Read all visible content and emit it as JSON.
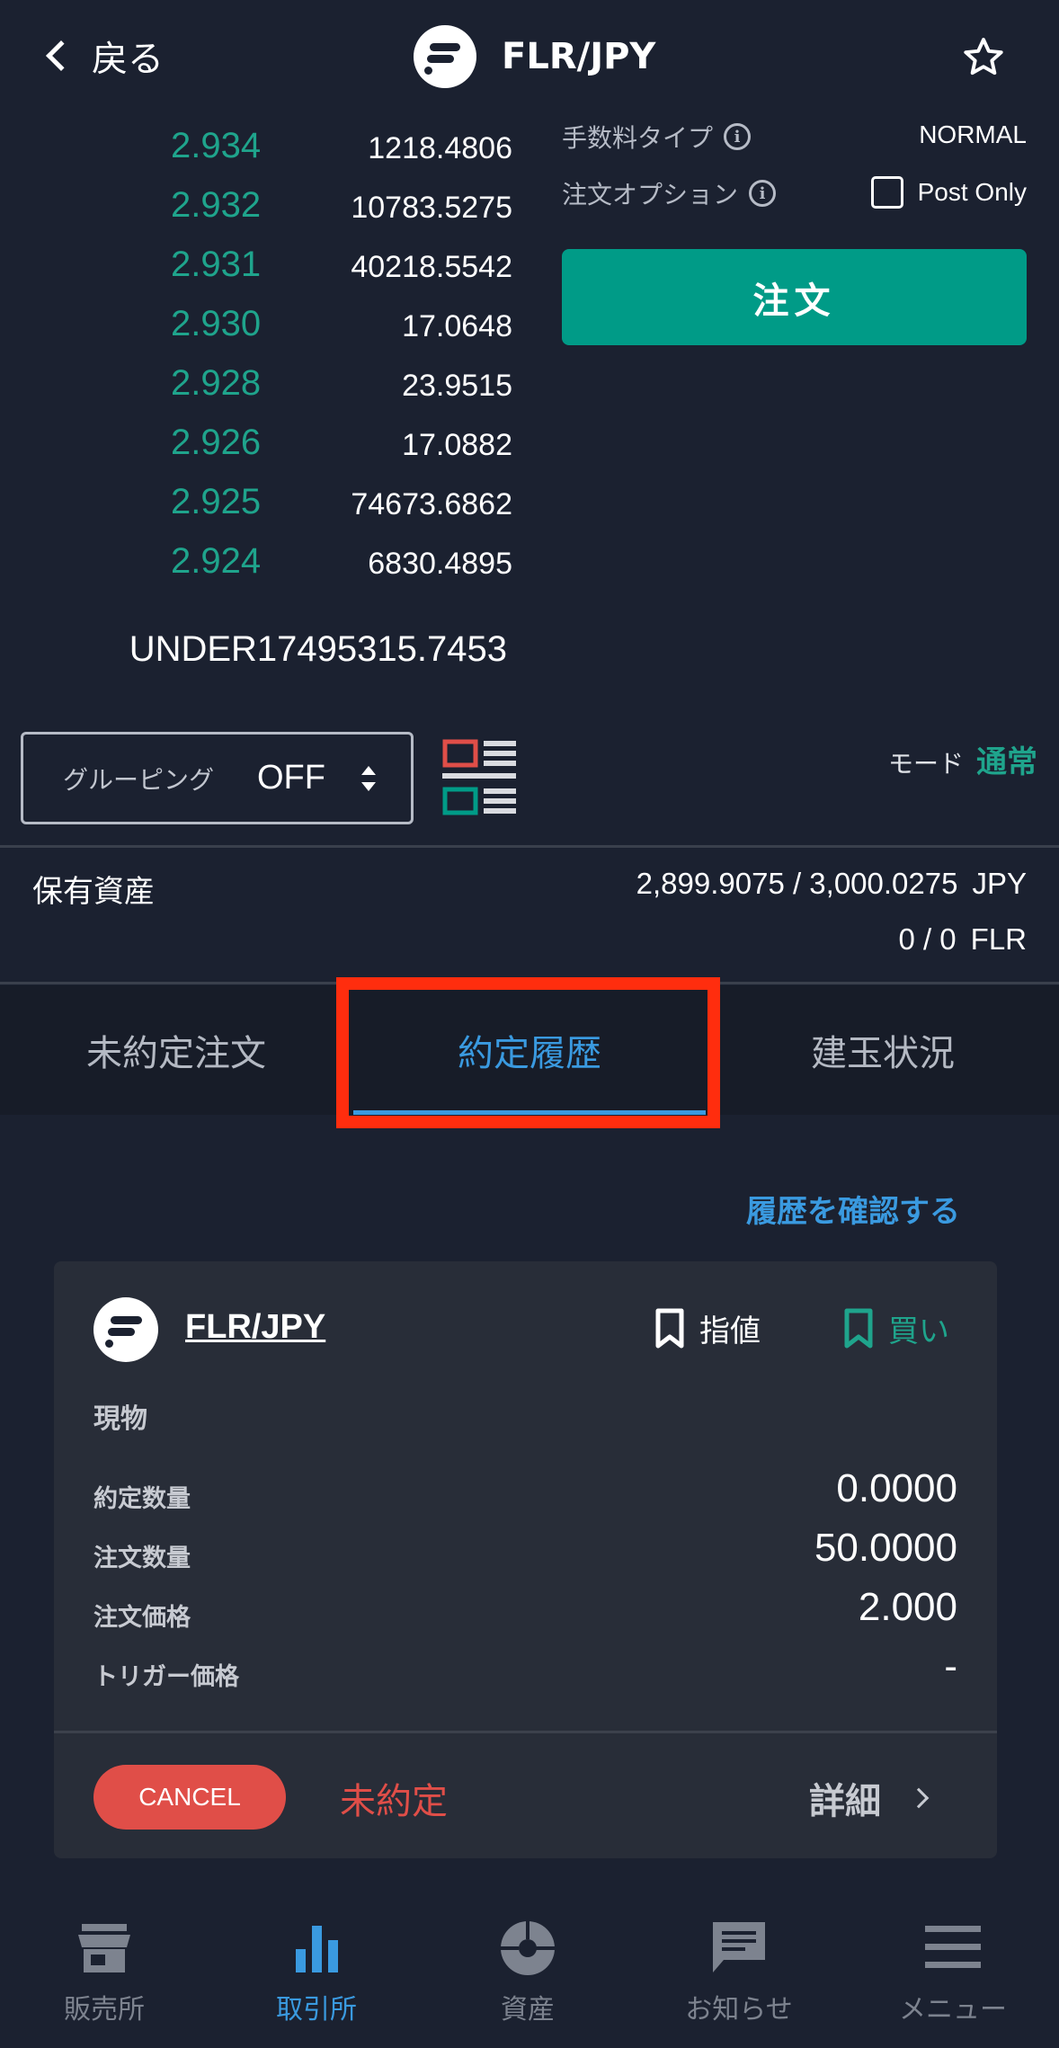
{
  "header": {
    "back_label": "戻る",
    "pair": "FLR/JPY"
  },
  "order_book": {
    "rows": [
      {
        "price": "2.934",
        "qty": "1218.4806"
      },
      {
        "price": "2.932",
        "qty": "10783.5275"
      },
      {
        "price": "2.931",
        "qty": "40218.5542"
      },
      {
        "price": "2.930",
        "qty": "17.0648"
      },
      {
        "price": "2.928",
        "qty": "23.9515"
      },
      {
        "price": "2.926",
        "qty": "17.0882"
      },
      {
        "price": "2.925",
        "qty": "74673.6862"
      },
      {
        "price": "2.924",
        "qty": "6830.4895"
      }
    ],
    "under": "UNDER17495315.7453"
  },
  "settings": {
    "fee_type_label": "手数料タイプ",
    "fee_type_value": "NORMAL",
    "order_option_label": "注文オプション",
    "post_only_label": "Post Only",
    "order_button": "注文"
  },
  "grouping": {
    "label": "グルーピング",
    "value": "OFF"
  },
  "mode": {
    "label": "モード",
    "value": "通常"
  },
  "assets": {
    "label": "保有資産",
    "jpy_amount": "2,899.9075 / 3,000.0275",
    "jpy_unit": "JPY",
    "flr_amount": "0 / 0",
    "flr_unit": "FLR"
  },
  "tabs": [
    {
      "label": "未約定注文",
      "active": false
    },
    {
      "label": "約定履歴",
      "active": true
    },
    {
      "label": "建玉状況",
      "active": false
    }
  ],
  "history_link": "履歴を確認する",
  "order_card": {
    "pair": "FLR/JPY",
    "order_type": "指値",
    "side": "買い",
    "category": "現物",
    "rows": [
      {
        "label": "約定数量",
        "value": "0.0000"
      },
      {
        "label": "注文数量",
        "value": "50.0000"
      },
      {
        "label": "注文価格",
        "value": "2.000"
      },
      {
        "label": "トリガー価格",
        "value": "-"
      }
    ],
    "cancel_label": "CANCEL",
    "status": "未約定",
    "detail_label": "詳細"
  },
  "bottom_nav": [
    {
      "label": "販売所",
      "icon": "store-icon",
      "active": false
    },
    {
      "label": "取引所",
      "icon": "bar-chart-icon",
      "active": true
    },
    {
      "label": "資産",
      "icon": "pie-chart-icon",
      "active": false
    },
    {
      "label": "お知らせ",
      "icon": "message-icon",
      "active": false
    },
    {
      "label": "メニュー",
      "icon": "menu-icon",
      "active": false
    }
  ],
  "colors": {
    "background": "#1b2130",
    "accent_green": "#009b87",
    "price_green": "#1fa48c",
    "accent_blue": "#3a9ae0",
    "cancel_red": "#e04e48",
    "highlight_red": "#ff2d0e"
  }
}
